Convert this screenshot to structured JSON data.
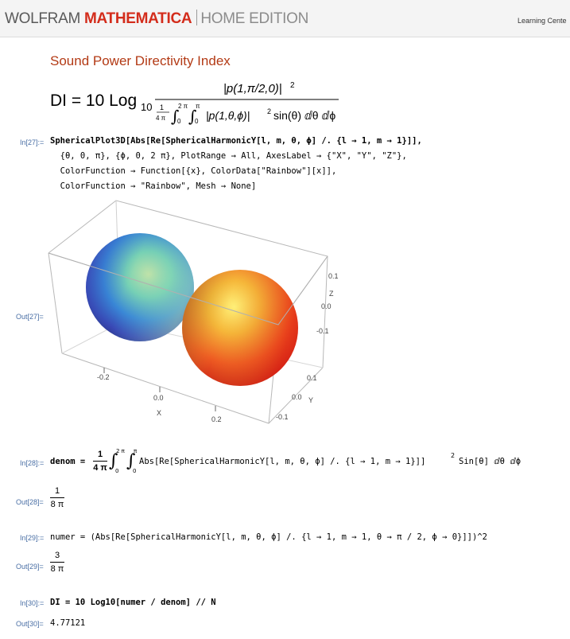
{
  "header": {
    "brand_wolfram": "WOLFRAM",
    "brand_mathematica": "MATHEMATICA",
    "brand_edition": "HOME EDITION",
    "learning_link": "Learning Cente"
  },
  "section": {
    "title": "Sound Power Directivity Index"
  },
  "formula": {
    "lhs": "DI = 10 Log",
    "sub": "10",
    "numerator": "|p(1,π/2,0)|",
    "num_power": "2",
    "den_frac_num": "1",
    "den_frac_den": "4 π",
    "int1_upper": "2 π",
    "int1_lower": "0",
    "int2_upper": "π",
    "int2_lower": "0",
    "den_body": "|p(1,θ,ϕ)|",
    "den_power": "2",
    "den_tail": "sin(θ) ⅆθ ⅆϕ"
  },
  "cells": {
    "in27": {
      "label": "In[27]:=",
      "line1": "SphericalPlot3D[Abs[Re[SphericalHarmonicY[l, m, θ, ϕ] /. {l → 1, m → 1}]],",
      "line2": "  {θ, 0, π}, {ϕ, 0, 2 π}, PlotRange → All, AxesLabel → {\"X\", \"Y\", \"Z\"},",
      "line3": "  ColorFunction → Function[{x}, ColorData[\"Rainbow\"][x]],",
      "line4": "  ColorFunction → \"Rainbow\", Mesh → None]"
    },
    "out27": {
      "label": "Out[27]="
    },
    "in28": {
      "label": "In[28]:=",
      "lhs": "denom =",
      "frac_num": "1",
      "frac_den": "4 π",
      "int1_upper": "2 π",
      "int1_lower": "0",
      "int2_upper": "π",
      "int2_lower": "0",
      "body": "Abs[Re[SphericalHarmonicY[l, m, θ, ϕ] /. {l → 1, m → 1}]]",
      "power": "2",
      "tail": "Sin[θ] ⅆθ ⅆϕ"
    },
    "out28": {
      "label": "Out[28]=",
      "num": "1",
      "den": "8 π"
    },
    "in29": {
      "label": "In[29]:=",
      "code": "numer = (Abs[Re[SphericalHarmonicY[l, m, θ, ϕ] /. {l → 1, m → 1, θ → π / 2, ϕ → 0}]])^2"
    },
    "out29": {
      "label": "Out[29]=",
      "num": "3",
      "den": "8 π"
    },
    "in30": {
      "label": "In[30]:=",
      "code": "DI = 10 Log10[numer / denom] // N"
    },
    "out30": {
      "label": "Out[30]=",
      "value": "4.77121"
    }
  },
  "plot": {
    "x_ticks": [
      "-0.2",
      "0.0",
      "0.2"
    ],
    "x_label": "X",
    "y_ticks": [
      "0.1",
      "0.0",
      "-0.1"
    ],
    "y_label": "Y",
    "z_ticks": [
      "0.1",
      "0.0",
      "-0.1"
    ],
    "z_label": "Z"
  },
  "colors": {
    "brand_red": "#d32c1b",
    "title_orange": "#b33a15",
    "cell_label_blue": "#4a6fa5"
  }
}
